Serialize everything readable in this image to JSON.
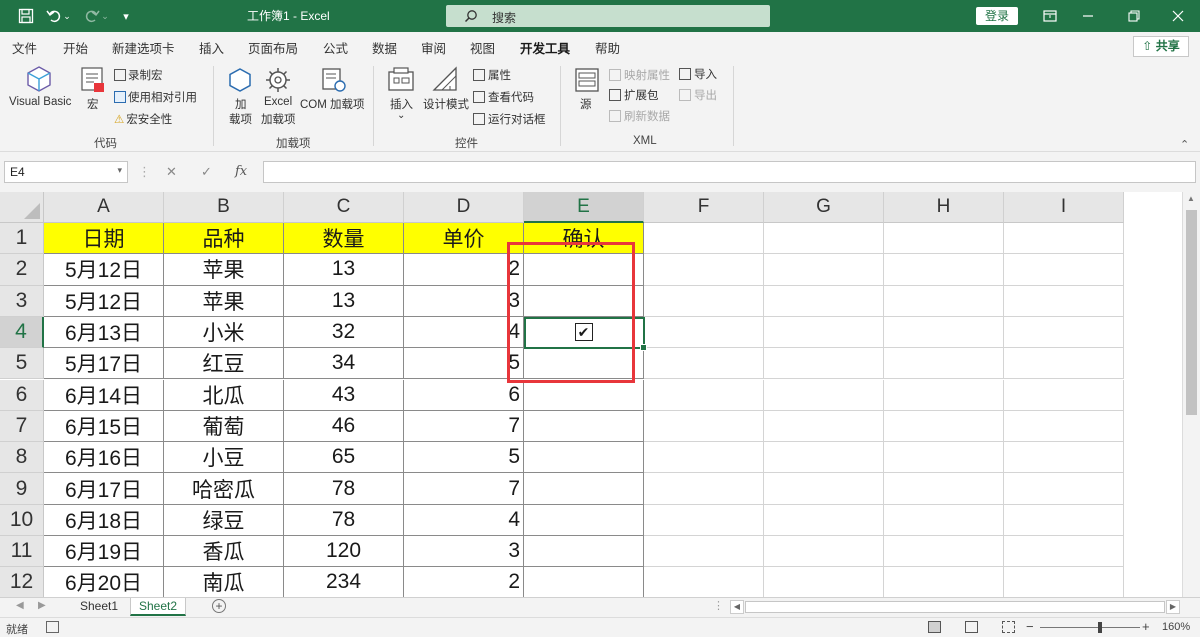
{
  "titlebar": {
    "title": "工作簿1  -  Excel",
    "search_placeholder": "搜索",
    "login_label": "登录"
  },
  "menu": {
    "items": [
      "文件",
      "开始",
      "新建选项卡",
      "插入",
      "页面布局",
      "公式",
      "数据",
      "审阅",
      "视图",
      "开发工具",
      "帮助"
    ],
    "active": "开发工具",
    "share_label": "共享"
  },
  "ribbon": {
    "code": {
      "label": "代码",
      "visual_basic": "Visual Basic",
      "macro": "宏",
      "record_macro": "录制宏",
      "relative_ref": "使用相对引用",
      "macro_security": "宏安全性"
    },
    "addins": {
      "label": "加载项",
      "add_line1": "加",
      "add_line2": "载项",
      "excel_line1": "Excel",
      "excel_line2": "加载项",
      "com": "COM 加载项"
    },
    "controls": {
      "label": "控件",
      "insert": "插入",
      "design_mode": "设计模式",
      "properties": "属性",
      "view_code": "查看代码",
      "run_dialog": "运行对话框"
    },
    "xml": {
      "label": "XML",
      "source": "源",
      "map_properties": "映射属性",
      "expansion_packs": "扩展包",
      "refresh_data": "刷新数据",
      "import": "导入",
      "export": "导出"
    }
  },
  "formula_bar": {
    "name_box": "E4",
    "fx": "fx",
    "value": ""
  },
  "sheet": {
    "columns": [
      "A",
      "B",
      "C",
      "D",
      "E",
      "F",
      "G",
      "H",
      "I"
    ],
    "selected_column": "E",
    "selected_row": "4",
    "header_row": [
      "日期",
      "品种",
      "数量",
      "单价",
      "确认"
    ],
    "rows": [
      {
        "num": "2",
        "date": "5月12日",
        "item": "苹果",
        "qty": "13",
        "price": "2",
        "checked": false
      },
      {
        "num": "3",
        "date": "5月12日",
        "item": "苹果",
        "qty": "13",
        "price": "3",
        "checked": false
      },
      {
        "num": "4",
        "date": "6月13日",
        "item": "小米",
        "qty": "32",
        "price": "4",
        "checked": true
      },
      {
        "num": "5",
        "date": "5月17日",
        "item": "红豆",
        "qty": "34",
        "price": "5",
        "checked": false
      },
      {
        "num": "6",
        "date": "6月14日",
        "item": "北瓜",
        "qty": "43",
        "price": "6",
        "checked": false
      },
      {
        "num": "7",
        "date": "6月15日",
        "item": "葡萄",
        "qty": "46",
        "price": "7",
        "checked": false
      },
      {
        "num": "8",
        "date": "6月16日",
        "item": "小豆",
        "qty": "65",
        "price": "5",
        "checked": false
      },
      {
        "num": "9",
        "date": "6月17日",
        "item": "哈密瓜",
        "qty": "78",
        "price": "7",
        "checked": false
      },
      {
        "num": "10",
        "date": "6月18日",
        "item": "绿豆",
        "qty": "78",
        "price": "4",
        "checked": false
      },
      {
        "num": "11",
        "date": "6月19日",
        "item": "香瓜",
        "qty": "120",
        "price": "3",
        "checked": false
      },
      {
        "num": "12",
        "date": "6月20日",
        "item": "南瓜",
        "qty": "234",
        "price": "2",
        "checked": false
      }
    ],
    "header_row_number": "1",
    "checkmark": "✔"
  },
  "tabs": {
    "sheets": [
      "Sheet1",
      "Sheet2"
    ],
    "active": "Sheet2"
  },
  "status": {
    "ready": "就绪",
    "zoom": "160%"
  },
  "colors": {
    "accent": "#217346",
    "header_fill": "#ffff00",
    "annotation": "#e8363b"
  }
}
